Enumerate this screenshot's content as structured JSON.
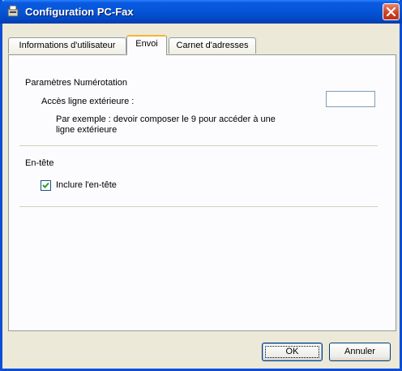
{
  "window": {
    "title": "Configuration PC-Fax",
    "titlebar_color": "#0556d8"
  },
  "tabs": [
    {
      "label": "Informations d'utilisateur",
      "active": false
    },
    {
      "label": "Envoi",
      "active": true
    },
    {
      "label": "Carnet d'adresses",
      "active": false
    }
  ],
  "dialing": {
    "group_label": "Paramètres Numérotation",
    "outside_line_label": "Accès ligne extérieure :",
    "outside_line_value": "",
    "example_line1": "Par exemple : devoir composer le 9 pour accéder à une",
    "example_line2": "ligne extérieure"
  },
  "header": {
    "group_label": "En-tête",
    "include_label": "Inclure l'en-tête",
    "include_checked": true
  },
  "buttons": {
    "ok_label": "OK",
    "cancel_label": "Annuler"
  },
  "icons": {
    "title": "fax-app-icon",
    "close": "close-icon",
    "check": "checkmark-icon"
  }
}
